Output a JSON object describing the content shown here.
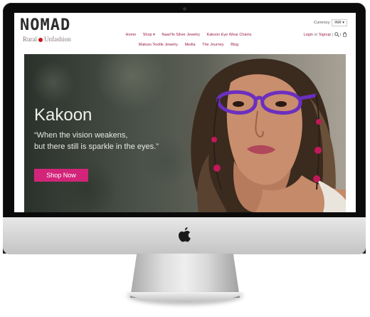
{
  "site": {
    "logo_name": "NOMAD",
    "logo_tag_left": "Rural",
    "logo_tag_right": "Unfashion"
  },
  "nav": {
    "row1": [
      "Home",
      "Shop ▾",
      "Naarl'ki Silver Jewelry",
      "Kakoon Eye Wear Chains"
    ],
    "row2": [
      "Makutu Textile Jewelry",
      "Media",
      "The Journey",
      "Blog"
    ]
  },
  "header": {
    "currency_label": "Currency:",
    "currency_value": "INR ▾",
    "login": "Login",
    "or": "or",
    "signup": "Signup",
    "search_icon": "search-icon",
    "cart_icon": "cart-icon"
  },
  "hero": {
    "heading": "Kakoon",
    "quote_line1": "“When the vision weakens,",
    "quote_line2": "but there still is sparkle in the eyes.”",
    "button": "Shop Now"
  },
  "colors": {
    "accent": "#d2257a",
    "nav": "#9b1d4b",
    "logo_dot": "#c4161c"
  },
  "device": {
    "logo_icon": "apple-logo-icon"
  }
}
